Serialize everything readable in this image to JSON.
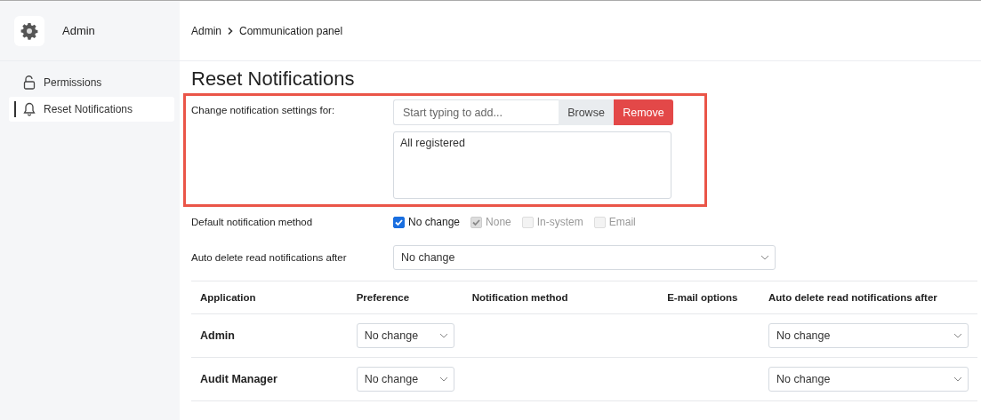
{
  "app": {
    "name": "Admin"
  },
  "sidebar": {
    "items": [
      {
        "label": "Permissions",
        "kind": "lock",
        "selected": false
      },
      {
        "label": "Reset Notifications",
        "kind": "bell",
        "selected": true
      }
    ]
  },
  "breadcrumb": [
    {
      "label": "Admin"
    },
    {
      "label": "Communication panel"
    }
  ],
  "page_title": "Reset Notifications",
  "settings_for": {
    "label": "Change notification settings for:",
    "highlighted": true,
    "search": {
      "placeholder": "Start typing to add..."
    },
    "browse_button": "Browse",
    "remove_button": "Remove",
    "selected_list": [
      "All registered"
    ]
  },
  "default_method": {
    "label": "Default notification method",
    "options": [
      {
        "label": "No change",
        "checked": true,
        "disabled": false
      },
      {
        "label": "None",
        "checked": true,
        "disabled": true
      },
      {
        "label": "In-system",
        "checked": false,
        "disabled": true
      },
      {
        "label": "Email",
        "checked": false,
        "disabled": true
      }
    ]
  },
  "auto_delete": {
    "label": "Auto delete read notifications after",
    "value": "No change"
  },
  "table": {
    "columns": [
      "Application",
      "Preference",
      "Notification method",
      "E-mail options",
      "Auto delete read notifications after"
    ],
    "rows": [
      {
        "application": "Admin",
        "preference": "No change",
        "auto_delete": "No change"
      },
      {
        "application": "Audit Manager",
        "preference": "No change",
        "auto_delete": "No change"
      }
    ]
  }
}
